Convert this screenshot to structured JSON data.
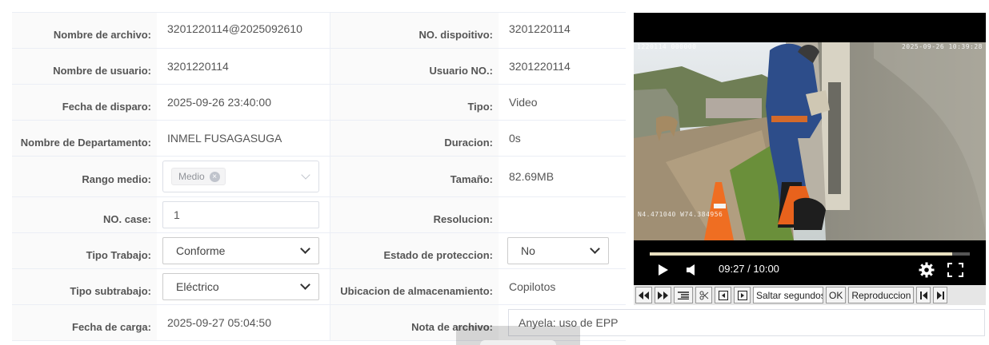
{
  "form": {
    "rows": [
      {
        "label1": "Nombre de archivo:",
        "value1": "3201220114@2025092610",
        "label2": "NO. dispoitivo:",
        "value2": "3201220114"
      },
      {
        "label1": "Nombre de usuario:",
        "value1": "3201220114",
        "label2": "Usuario NO.:",
        "value2": "3201220114"
      },
      {
        "label1": "Fecha de disparo:",
        "value1": "2025-09-26 23:40:00",
        "label2": "Tipo:",
        "value2": "Video"
      },
      {
        "label1": "Nombre de Departamento:",
        "value1": "INMEL FUSAGASUGA",
        "label2": "Duracion:",
        "value2": "0s"
      },
      {
        "label1": "Rango medio:",
        "value1": "Medio",
        "label2": "Tamaño:",
        "value2": "82.69MB"
      },
      {
        "label1": "NO. case:",
        "value1": "1",
        "label2": "Resolucion:",
        "value2": ""
      },
      {
        "label1": "Tipo Trabajo:",
        "value1": "Conforme",
        "label2": "Estado de proteccion:",
        "value2": "No"
      },
      {
        "label1": "Tipo subtrabajo:",
        "value1": "Eléctrico",
        "label2": "Ubicacion de almacenamiento:",
        "value2": "Copilotos"
      },
      {
        "label1": "Fecha de carga:",
        "value1": "2025-09-27 05:04:50",
        "label2": "Nota de archivo:",
        "value2": "Anyela: uso de EPP"
      }
    ],
    "tag_close_icon": "×"
  },
  "player": {
    "osd_left": "1220114 000000",
    "osd_right": "2025-09-26 10:39:28",
    "osd_gps": "N4.471040  W74.384956",
    "time": "09:27 / 10:00",
    "progress": 0.945
  },
  "toolbar": {
    "skip_placeholder": "Saltar segundos",
    "ok_label": "OK",
    "reproduce_label": "Reproduccion"
  },
  "icons": [
    "play-icon",
    "volume-icon",
    "settings-icon",
    "fullscreen-icon",
    "fast-backward-icon",
    "fast-forward-icon",
    "list-icon",
    "scissors-icon",
    "prev-frame-icon",
    "next-frame-icon",
    "skip-start-icon",
    "skip-end-icon"
  ]
}
